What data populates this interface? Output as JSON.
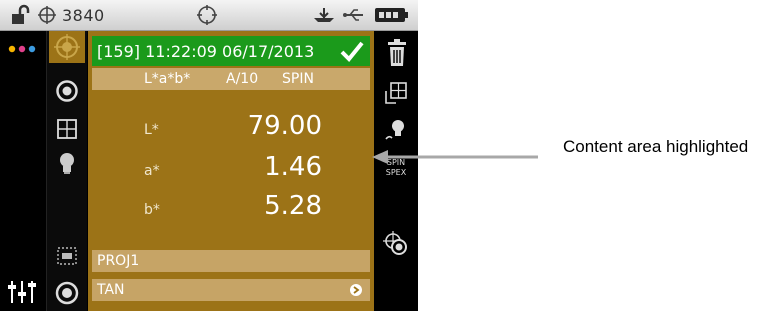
{
  "status_bar": {
    "count": "3840"
  },
  "content": {
    "header": "[159] 11:22:09 06/17/2013",
    "mode_space": "L*a*b*",
    "mode_illum": "A/10",
    "mode_spec": "SPIN",
    "readings": [
      {
        "label": "L*",
        "value": "79.00"
      },
      {
        "label": "a*",
        "value": "1.46"
      },
      {
        "label": "b*",
        "value": "5.28"
      }
    ],
    "project": "PROJ1",
    "standard": "TAN"
  },
  "right_panel": {
    "spin_label": "SPIN",
    "spex_label": "SPEX"
  },
  "annotation": "Content area highlighted",
  "colors": {
    "content_bg": "#9c7317",
    "header_ok": "#1b9a1b",
    "bar_bg": "#c6a466"
  }
}
